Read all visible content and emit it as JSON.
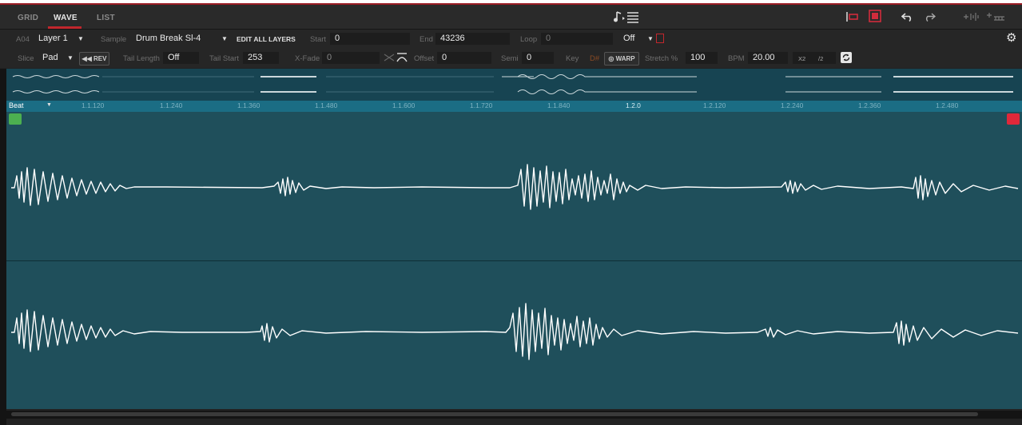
{
  "tabs": [
    {
      "label": "GRID"
    },
    {
      "label": "WAVE",
      "active": true
    },
    {
      "label": "LIST"
    }
  ],
  "header_icons": [
    "note-list-icon",
    "slice-marker-icon",
    "select-region-icon",
    "undo-icon",
    "redo-icon",
    "split-icon",
    "grid-split-icon"
  ],
  "row1": {
    "pad_id": "A04",
    "layer": "Layer 1",
    "sample_label": "Sample",
    "sample_value": "Drum Break Sl-4",
    "edit_all_layers": "EDIT ALL LAYERS",
    "start_label": "Start",
    "start_value": "0",
    "end_label": "End",
    "end_value": "43236",
    "loop_label": "Loop",
    "loop_value": "0",
    "loop_mode": "Off"
  },
  "row2": {
    "slice_label": "Slice",
    "slice_value": "Pad",
    "rev_label": "◀◀ REV",
    "tail_length_label": "Tail Length",
    "tail_length_value": "Off",
    "tail_start_label": "Tail Start",
    "tail_start_value": "253",
    "xfade_label": "X-Fade",
    "xfade_value": "0",
    "offset_label": "Offset",
    "offset_value": "0",
    "semi_label": "Semi",
    "semi_value": "0",
    "key_label": "Key",
    "key_value": "D#",
    "warp_label": "◎ WARP",
    "stretch_label": "Stretch %",
    "stretch_value": "100",
    "bpm_label": "BPM",
    "bpm_value": "20.00",
    "x2_label": "X2",
    "div2_label": "/2"
  },
  "ruler": {
    "beat_label": "Beat",
    "ticks": [
      "1.1.120",
      "1.1.240",
      "1.1.360",
      "1.1.480",
      "1.1.600",
      "1.1.720",
      "1.1.840",
      "1.2.0",
      "1.2.120",
      "1.2.240",
      "1.2.360",
      "1.2.480"
    ]
  },
  "colors": {
    "accent": "#c1272d",
    "wave_bg": "#1f4f5b",
    "ruler_bg": "#1b6d84",
    "start_marker": "#4caf50",
    "end_marker": "#e0283a"
  }
}
